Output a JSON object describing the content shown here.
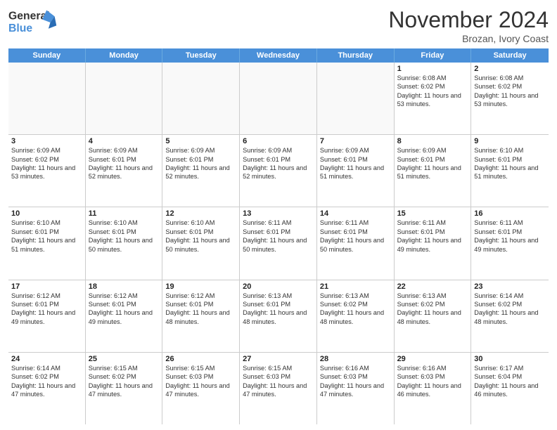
{
  "logo": {
    "general": "General",
    "blue": "Blue"
  },
  "title": "November 2024",
  "location": "Brozan, Ivory Coast",
  "weekdays": [
    "Sunday",
    "Monday",
    "Tuesday",
    "Wednesday",
    "Thursday",
    "Friday",
    "Saturday"
  ],
  "rows": [
    [
      {
        "day": "",
        "empty": true
      },
      {
        "day": "",
        "empty": true
      },
      {
        "day": "",
        "empty": true
      },
      {
        "day": "",
        "empty": true
      },
      {
        "day": "",
        "empty": true
      },
      {
        "day": "1",
        "sunrise": "6:08 AM",
        "sunset": "6:02 PM",
        "daylight": "11 hours and 53 minutes."
      },
      {
        "day": "2",
        "sunrise": "6:08 AM",
        "sunset": "6:02 PM",
        "daylight": "11 hours and 53 minutes."
      }
    ],
    [
      {
        "day": "3",
        "sunrise": "6:09 AM",
        "sunset": "6:02 PM",
        "daylight": "11 hours and 53 minutes."
      },
      {
        "day": "4",
        "sunrise": "6:09 AM",
        "sunset": "6:01 PM",
        "daylight": "11 hours and 52 minutes."
      },
      {
        "day": "5",
        "sunrise": "6:09 AM",
        "sunset": "6:01 PM",
        "daylight": "11 hours and 52 minutes."
      },
      {
        "day": "6",
        "sunrise": "6:09 AM",
        "sunset": "6:01 PM",
        "daylight": "11 hours and 52 minutes."
      },
      {
        "day": "7",
        "sunrise": "6:09 AM",
        "sunset": "6:01 PM",
        "daylight": "11 hours and 51 minutes."
      },
      {
        "day": "8",
        "sunrise": "6:09 AM",
        "sunset": "6:01 PM",
        "daylight": "11 hours and 51 minutes."
      },
      {
        "day": "9",
        "sunrise": "6:10 AM",
        "sunset": "6:01 PM",
        "daylight": "11 hours and 51 minutes."
      }
    ],
    [
      {
        "day": "10",
        "sunrise": "6:10 AM",
        "sunset": "6:01 PM",
        "daylight": "11 hours and 51 minutes."
      },
      {
        "day": "11",
        "sunrise": "6:10 AM",
        "sunset": "6:01 PM",
        "daylight": "11 hours and 50 minutes."
      },
      {
        "day": "12",
        "sunrise": "6:10 AM",
        "sunset": "6:01 PM",
        "daylight": "11 hours and 50 minutes."
      },
      {
        "day": "13",
        "sunrise": "6:11 AM",
        "sunset": "6:01 PM",
        "daylight": "11 hours and 50 minutes."
      },
      {
        "day": "14",
        "sunrise": "6:11 AM",
        "sunset": "6:01 PM",
        "daylight": "11 hours and 50 minutes."
      },
      {
        "day": "15",
        "sunrise": "6:11 AM",
        "sunset": "6:01 PM",
        "daylight": "11 hours and 49 minutes."
      },
      {
        "day": "16",
        "sunrise": "6:11 AM",
        "sunset": "6:01 PM",
        "daylight": "11 hours and 49 minutes."
      }
    ],
    [
      {
        "day": "17",
        "sunrise": "6:12 AM",
        "sunset": "6:01 PM",
        "daylight": "11 hours and 49 minutes."
      },
      {
        "day": "18",
        "sunrise": "6:12 AM",
        "sunset": "6:01 PM",
        "daylight": "11 hours and 49 minutes."
      },
      {
        "day": "19",
        "sunrise": "6:12 AM",
        "sunset": "6:01 PM",
        "daylight": "11 hours and 48 minutes."
      },
      {
        "day": "20",
        "sunrise": "6:13 AM",
        "sunset": "6:01 PM",
        "daylight": "11 hours and 48 minutes."
      },
      {
        "day": "21",
        "sunrise": "6:13 AM",
        "sunset": "6:02 PM",
        "daylight": "11 hours and 48 minutes."
      },
      {
        "day": "22",
        "sunrise": "6:13 AM",
        "sunset": "6:02 PM",
        "daylight": "11 hours and 48 minutes."
      },
      {
        "day": "23",
        "sunrise": "6:14 AM",
        "sunset": "6:02 PM",
        "daylight": "11 hours and 48 minutes."
      }
    ],
    [
      {
        "day": "24",
        "sunrise": "6:14 AM",
        "sunset": "6:02 PM",
        "daylight": "11 hours and 47 minutes."
      },
      {
        "day": "25",
        "sunrise": "6:15 AM",
        "sunset": "6:02 PM",
        "daylight": "11 hours and 47 minutes."
      },
      {
        "day": "26",
        "sunrise": "6:15 AM",
        "sunset": "6:03 PM",
        "daylight": "11 hours and 47 minutes."
      },
      {
        "day": "27",
        "sunrise": "6:15 AM",
        "sunset": "6:03 PM",
        "daylight": "11 hours and 47 minutes."
      },
      {
        "day": "28",
        "sunrise": "6:16 AM",
        "sunset": "6:03 PM",
        "daylight": "11 hours and 47 minutes."
      },
      {
        "day": "29",
        "sunrise": "6:16 AM",
        "sunset": "6:03 PM",
        "daylight": "11 hours and 46 minutes."
      },
      {
        "day": "30",
        "sunrise": "6:17 AM",
        "sunset": "6:04 PM",
        "daylight": "11 hours and 46 minutes."
      }
    ]
  ]
}
